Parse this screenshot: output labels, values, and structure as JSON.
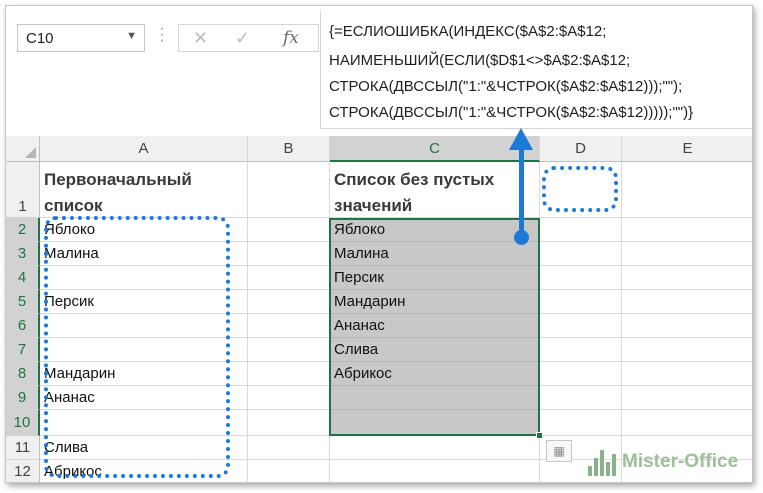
{
  "name_box": {
    "value": "C10",
    "dropdown_icon": "chevron-down-icon"
  },
  "formula_bar": {
    "cancel_icon": "✕",
    "enter_icon": "✓",
    "function_icon": "fx",
    "lines": [
      "{=ЕСЛИОШИБКА(ИНДЕКС($A$2:$A$12;",
      "НАИМЕНЬШИЙ(ЕСЛИ($D$1<>$A$2:$A$12;",
      "СТРОКА(ДВССЫЛ(\"1:\"&ЧСТРОК($A$2:$A$12)));\"\");",
      "СТРОКА(ДВССЫЛ(\"1:\"&ЧСТРОК($A$2:$A$12)))));\"\")}"
    ]
  },
  "columns": [
    "A",
    "B",
    "C",
    "D",
    "E"
  ],
  "selected_column": "C",
  "rows": [
    "1",
    "2",
    "3",
    "4",
    "5",
    "6",
    "7",
    "8",
    "9",
    "10",
    "11",
    "12"
  ],
  "selected_rows": [
    "2",
    "3",
    "4",
    "5",
    "6",
    "7",
    "8",
    "9",
    "10"
  ],
  "row1": {
    "a_line1": "Первоначальный",
    "a_line2": "список",
    "c_line1": "Список без пустых",
    "c_line2": "значений"
  },
  "column_a": [
    "Яблоко",
    "Малина",
    "",
    "Персик",
    "",
    "",
    "Мандарин",
    "Ананас",
    "",
    "Слива",
    "Абрикос"
  ],
  "column_c": [
    "Яблоко",
    "Малина",
    "Персик",
    "Мандарин",
    "Ананас",
    "Слива",
    "Абрикос",
    "",
    "",
    "",
    ""
  ],
  "colors": {
    "excel_green": "#217346",
    "annotation_blue": "#1e78d6",
    "selection_shade": "#c8c8c8"
  },
  "watermark": {
    "text": "Mister-Office"
  }
}
